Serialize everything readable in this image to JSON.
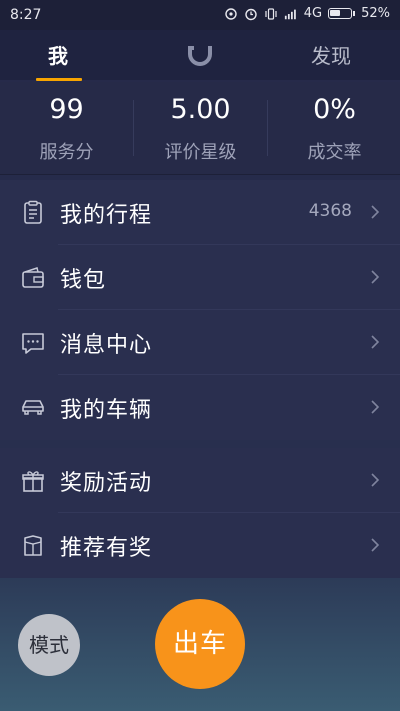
{
  "status_bar": {
    "time": "8:27",
    "network": "4G",
    "battery_percent": "52%",
    "battery_level": 0.52,
    "icons": [
      "alarm-icon",
      "vibrate-icon",
      "signal-icon",
      "battery-icon"
    ]
  },
  "header": {
    "tab_me": "我",
    "tab_discover": "发现",
    "logo_icon": "didi-logo-icon",
    "accent_color": "#f7a400"
  },
  "stats": [
    {
      "value": "99",
      "label": "服务分"
    },
    {
      "value": "5.00",
      "label": "评价星级"
    },
    {
      "value": "0%",
      "label": "成交率"
    }
  ],
  "menu": {
    "group1": [
      {
        "label": "我的行程",
        "count": "4368",
        "icon": "clipboard-icon"
      },
      {
        "label": "钱包",
        "count": "",
        "icon": "wallet-icon"
      },
      {
        "label": "消息中心",
        "count": "",
        "icon": "message-icon"
      },
      {
        "label": "我的车辆",
        "count": "",
        "icon": "car-icon"
      }
    ],
    "group2": [
      {
        "label": "奖励活动",
        "count": "",
        "icon": "gift-icon"
      },
      {
        "label": "推荐有奖",
        "count": "",
        "icon": "recommend-icon"
      }
    ]
  },
  "bottom": {
    "mode_label": "模式",
    "go_label": "出车",
    "go_color": "#f8931a"
  }
}
